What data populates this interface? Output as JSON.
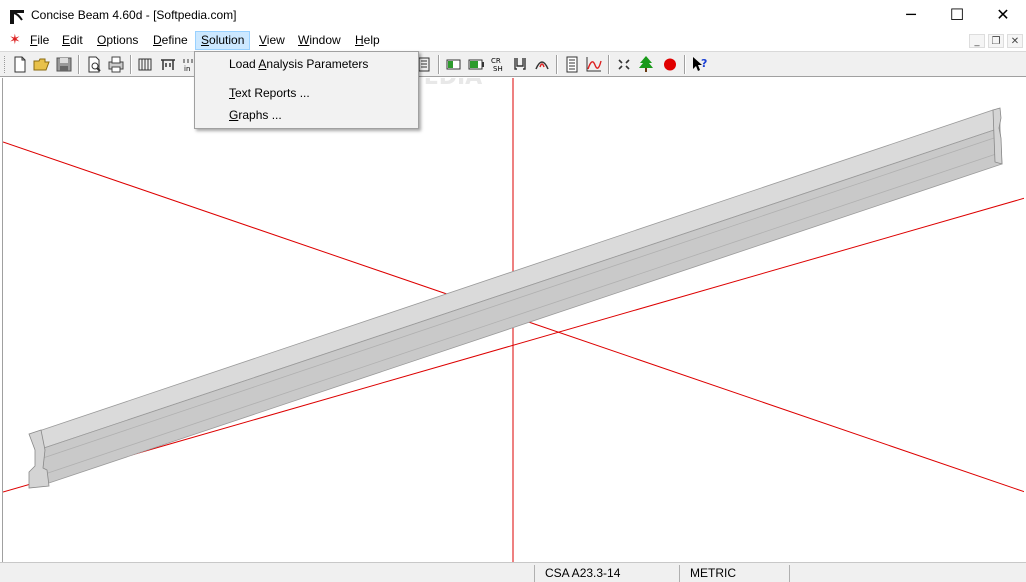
{
  "window": {
    "title": "Concise Beam 4.60d - [Softpedia.com]",
    "minimize": "─",
    "maximize": "☐",
    "close": "✕"
  },
  "menu": {
    "items": [
      {
        "pre": "",
        "ul": "F",
        "post": "ile"
      },
      {
        "pre": "",
        "ul": "E",
        "post": "dit"
      },
      {
        "pre": "",
        "ul": "O",
        "post": "ptions"
      },
      {
        "pre": "",
        "ul": "D",
        "post": "efine"
      },
      {
        "pre": "",
        "ul": "S",
        "post": "olution"
      },
      {
        "pre": "",
        "ul": "V",
        "post": "iew"
      },
      {
        "pre": "",
        "ul": "W",
        "post": "indow"
      },
      {
        "pre": "",
        "ul": "H",
        "post": "elp"
      }
    ],
    "active": "Solution",
    "mdi_min": "_",
    "mdi_restore": "❐",
    "mdi_close": "✕"
  },
  "solution_menu": {
    "items": [
      {
        "pre": "Load ",
        "ul": "A",
        "post": "nalysis Parameters"
      },
      {
        "pre": "",
        "ul": "T",
        "post": "ext Reports ..."
      },
      {
        "pre": "",
        "ul": "G",
        "post": "raphs ..."
      }
    ]
  },
  "toolbar": {
    "tools": [
      "new-file",
      "open-folder",
      "save-disk",
      "print-preview",
      "print",
      "beam-section",
      "define-1",
      "define-2",
      "hidden-1",
      "hidden-2",
      "report",
      "calculator",
      "calc-2",
      "cr-sh",
      "u-section",
      "arc-section",
      "report-list",
      "graph",
      "move",
      "tree",
      "stop-record",
      "help-pointer"
    ],
    "label_cr": "CR",
    "label_sh": "SH"
  },
  "status": {
    "code": "CSA A23.3-14",
    "units": "METRIC"
  },
  "watermark": "SOFTPEDIA",
  "colors": {
    "axis": "#dd0000",
    "beam_top": "#d8d8d8",
    "beam_side": "#c4c4c4",
    "menu_highlight": "#cce8ff"
  }
}
